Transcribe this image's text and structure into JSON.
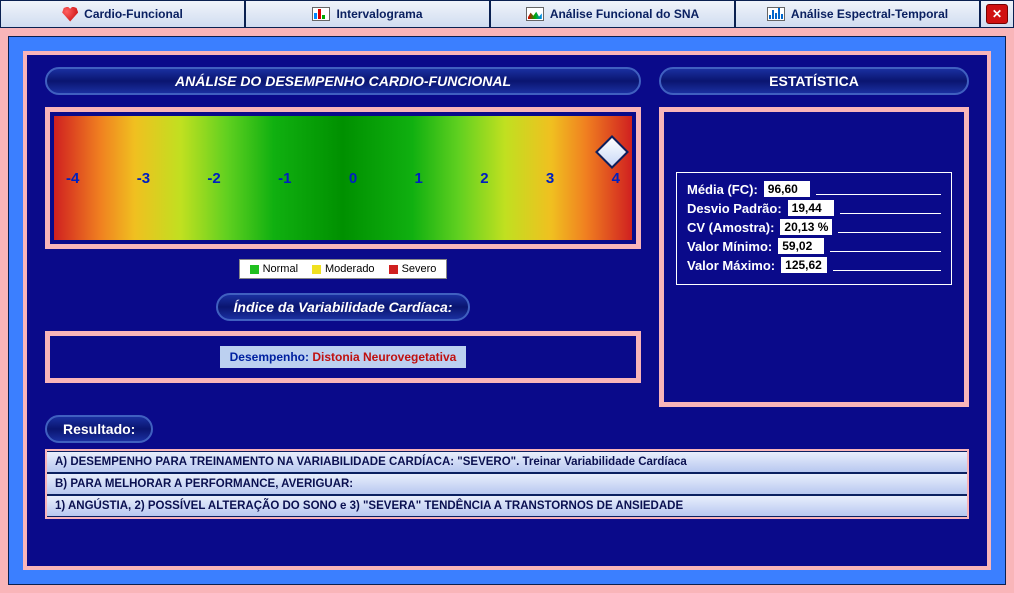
{
  "tabs": {
    "t1": "Cardio-Funcional",
    "t2": "Intervalograma",
    "t3": "Análise Funcional do SNA",
    "t4": "Análise Espectral-Temporal"
  },
  "headers": {
    "analysis": "ANÁLISE DO DESEMPENHO CARDIO-FUNCIONAL",
    "stats": "ESTATÍSTICA",
    "hrv": "Índice da Variabilidade Cardíaca:",
    "result": "Resultado:"
  },
  "scale": [
    "-4",
    "-3",
    "-2",
    "-1",
    "0",
    "1",
    "2",
    "3",
    "4"
  ],
  "legend": {
    "normal": "Normal",
    "moderate": "Moderado",
    "severe": "Severo"
  },
  "performance": {
    "prefix": "Desempenho: ",
    "value": "Distonia Neurovegetativa"
  },
  "stats": {
    "l_media": "Média (FC):",
    "v_media": "96,60",
    "l_dp": "Desvio Padrão:",
    "v_dp": "19,44",
    "l_cv": "CV (Amostra):",
    "v_cv": "20,13 %",
    "l_min": "Valor Mínimo:",
    "v_min": "59,02",
    "l_max": "Valor Máximo:",
    "v_max": "125,62"
  },
  "results": [
    "A) DESEMPENHO PARA TREINAMENTO NA VARIABILIDADE CARDÍACA: \"SEVERO\". Treinar Variabilidade Cardíaca",
    "B) PARA MELHORAR A PERFORMANCE, AVERIGUAR:",
    "1) ANGÚSTIA, 2) POSSÍVEL ALTERAÇÃO DO SONO e 3) \"SEVERA\" TENDÊNCIA A TRANSTORNOS DE ANSIEDADE"
  ]
}
